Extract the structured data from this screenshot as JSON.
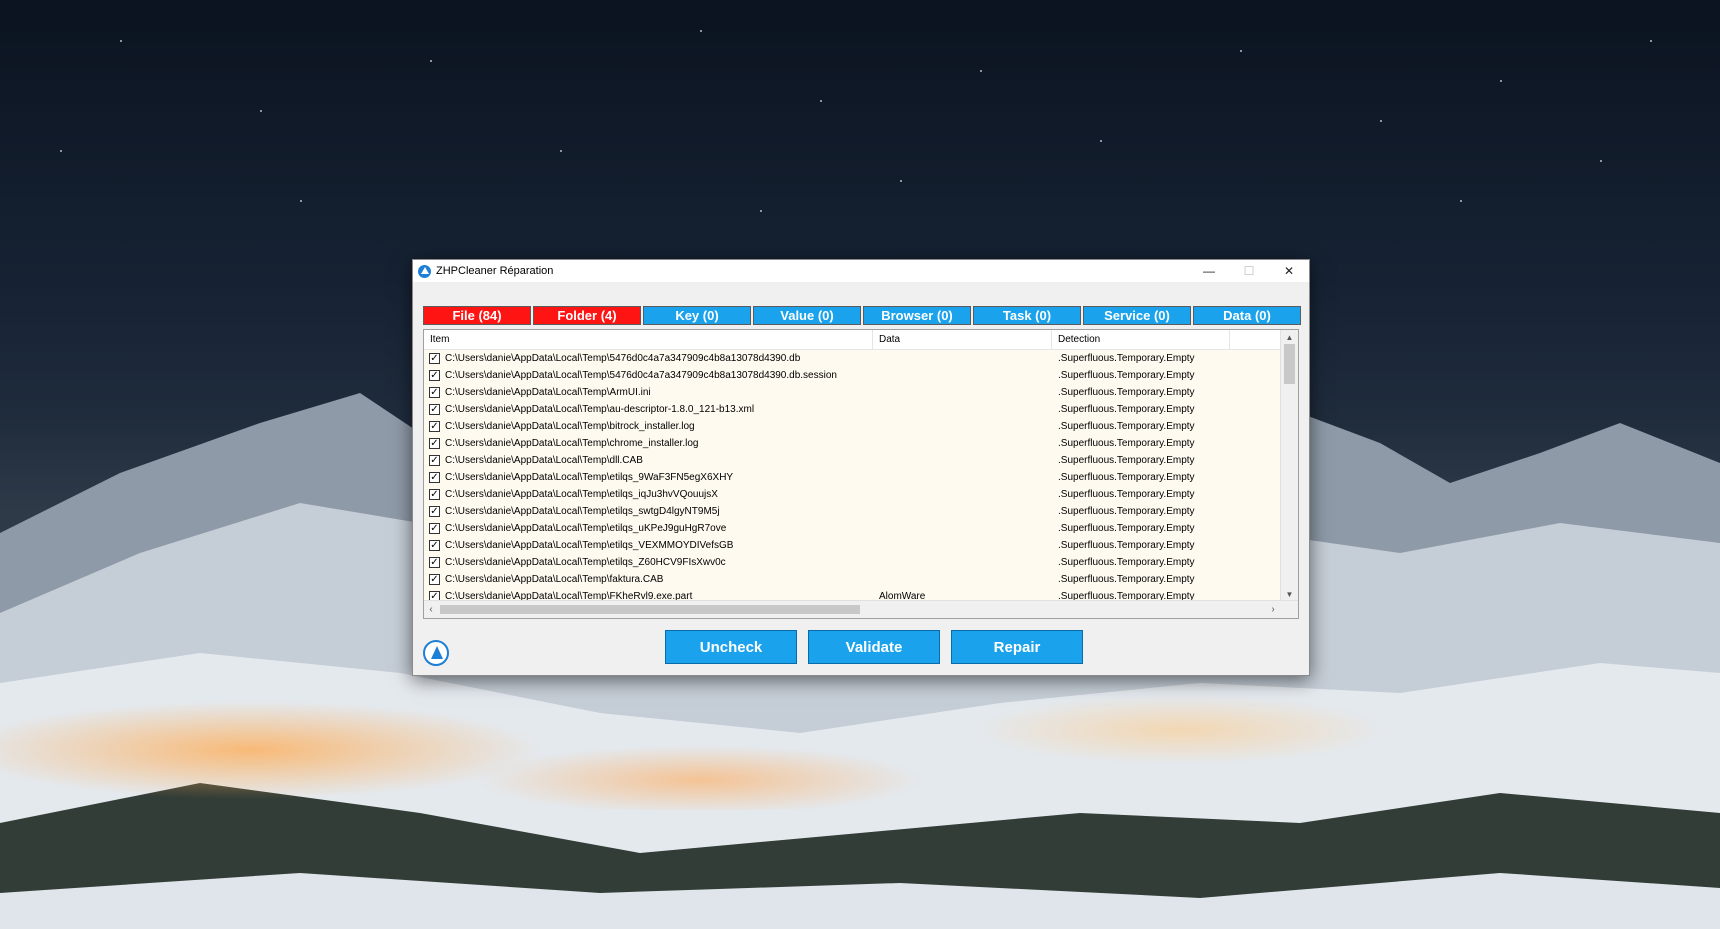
{
  "window": {
    "title": "ZHPCleaner Réparation",
    "controls": {
      "minimize": "—",
      "maximize": "☐",
      "close": "✕"
    }
  },
  "tabs": [
    {
      "label": "File  (84)",
      "color": "#ff1414"
    },
    {
      "label": "Folder  (4)",
      "color": "#ff1414"
    },
    {
      "label": "Key  (0)",
      "color": "#1aa3ec"
    },
    {
      "label": "Value  (0)",
      "color": "#1aa3ec"
    },
    {
      "label": "Browser  (0)",
      "color": "#1aa3ec"
    },
    {
      "label": "Task  (0)",
      "color": "#1aa3ec"
    },
    {
      "label": "Service  (0)",
      "color": "#1aa3ec"
    },
    {
      "label": "Data  (0)",
      "color": "#1aa3ec"
    }
  ],
  "list": {
    "columns": {
      "item": "Item",
      "data": "Data",
      "detection": "Detection"
    },
    "rows": [
      {
        "item": "C:\\Users\\danie\\AppData\\Local\\Temp\\5476d0c4a7a347909c4b8a13078d4390.db",
        "data": "",
        "detection": ".Superfluous.Temporary.Empty"
      },
      {
        "item": "C:\\Users\\danie\\AppData\\Local\\Temp\\5476d0c4a7a347909c4b8a13078d4390.db.session",
        "data": "",
        "detection": ".Superfluous.Temporary.Empty"
      },
      {
        "item": "C:\\Users\\danie\\AppData\\Local\\Temp\\ArmUI.ini",
        "data": "",
        "detection": ".Superfluous.Temporary.Empty"
      },
      {
        "item": "C:\\Users\\danie\\AppData\\Local\\Temp\\au-descriptor-1.8.0_121-b13.xml",
        "data": "",
        "detection": ".Superfluous.Temporary.Empty"
      },
      {
        "item": "C:\\Users\\danie\\AppData\\Local\\Temp\\bitrock_installer.log",
        "data": "",
        "detection": ".Superfluous.Temporary.Empty"
      },
      {
        "item": "C:\\Users\\danie\\AppData\\Local\\Temp\\chrome_installer.log",
        "data": "",
        "detection": ".Superfluous.Temporary.Empty"
      },
      {
        "item": "C:\\Users\\danie\\AppData\\Local\\Temp\\dll.CAB",
        "data": "",
        "detection": ".Superfluous.Temporary.Empty"
      },
      {
        "item": "C:\\Users\\danie\\AppData\\Local\\Temp\\etilqs_9WaF3FN5egX6XHY",
        "data": "",
        "detection": ".Superfluous.Temporary.Empty"
      },
      {
        "item": "C:\\Users\\danie\\AppData\\Local\\Temp\\etilqs_iqJu3hvVQouujsX",
        "data": "",
        "detection": ".Superfluous.Temporary.Empty"
      },
      {
        "item": "C:\\Users\\danie\\AppData\\Local\\Temp\\etilqs_swtgD4lgyNT9M5j",
        "data": "",
        "detection": ".Superfluous.Temporary.Empty"
      },
      {
        "item": "C:\\Users\\danie\\AppData\\Local\\Temp\\etilqs_uKPeJ9guHgR7ove",
        "data": "",
        "detection": ".Superfluous.Temporary.Empty"
      },
      {
        "item": "C:\\Users\\danie\\AppData\\Local\\Temp\\etilqs_VEXMMOYDIVefsGB",
        "data": "",
        "detection": ".Superfluous.Temporary.Empty"
      },
      {
        "item": "C:\\Users\\danie\\AppData\\Local\\Temp\\etilqs_Z60HCV9FIsXwv0c",
        "data": "",
        "detection": ".Superfluous.Temporary.Empty"
      },
      {
        "item": "C:\\Users\\danie\\AppData\\Local\\Temp\\faktura.CAB",
        "data": "",
        "detection": ".Superfluous.Temporary.Empty"
      },
      {
        "item": "C:\\Users\\danie\\AppData\\Local\\Temp\\FKheRvl9.exe.part",
        "data": "AlomWare",
        "detection": ".Superfluous.Temporary.Empty"
      }
    ]
  },
  "checkbox_mark": "✓",
  "scroll": {
    "up": "▲",
    "down": "▼",
    "left": "‹",
    "right": "›"
  },
  "actions": {
    "uncheck": "Uncheck",
    "validate": "Validate",
    "repair": "Repair"
  },
  "icons": {
    "app_logo": "zhpcleaner-logo-icon"
  }
}
